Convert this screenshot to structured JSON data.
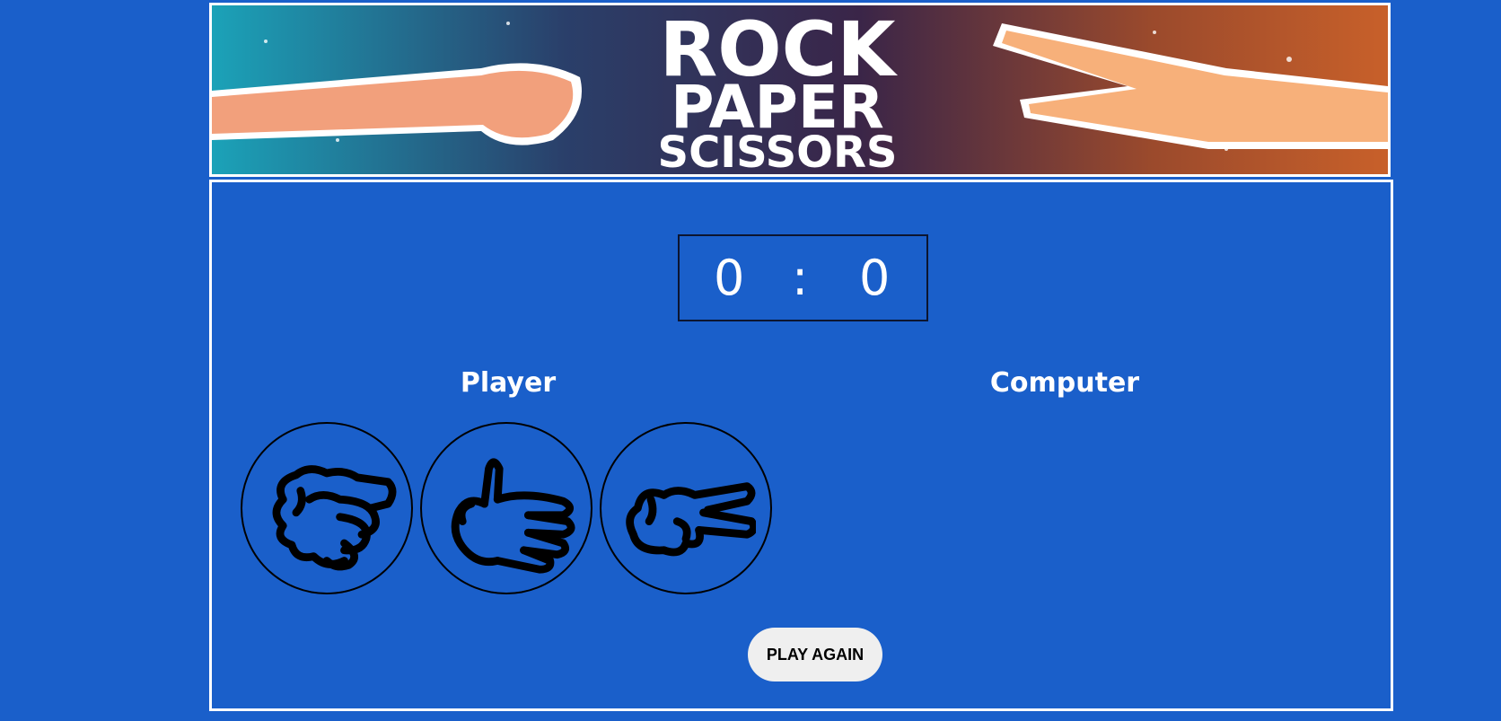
{
  "banner": {
    "title_lines": [
      "ROCK",
      "PAPER",
      "SCISSORS"
    ]
  },
  "score": {
    "player": "0",
    "separator": ":",
    "computer": "0"
  },
  "labels": {
    "player": "Player",
    "computer": "Computer"
  },
  "choices": [
    {
      "name": "rock",
      "icon": "rock-hand-icon"
    },
    {
      "name": "paper",
      "icon": "paper-hand-icon"
    },
    {
      "name": "scissors",
      "icon": "scissors-hand-icon"
    }
  ],
  "play_again_label": "PLAY AGAIN",
  "colors": {
    "background": "#1a5fca",
    "border": "#ffffff",
    "button_bg": "#efefef"
  }
}
